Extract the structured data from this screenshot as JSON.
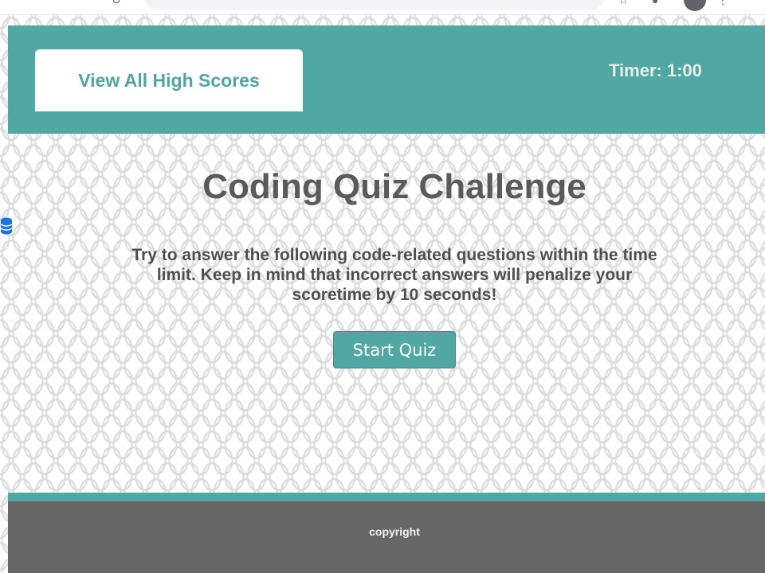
{
  "header": {
    "high_scores_label": "View All High Scores",
    "timer_label": "Timer:",
    "timer_value": "1:00"
  },
  "main": {
    "title": "Coding Quiz Challenge",
    "instructions": "Try to answer the following code-related questions within the time limit. Keep in mind that incorrect answers will penalize your scoretime by 10 seconds!",
    "start_label": "Start Quiz"
  },
  "footer": {
    "text": "copyright"
  },
  "colors": {
    "teal": "#50a8a4",
    "footer_gray": "#666666",
    "text_gray": "#5a5a5a"
  },
  "icons": [
    "profile-avatar-icon",
    "menu-dots-icon",
    "database-icon"
  ]
}
